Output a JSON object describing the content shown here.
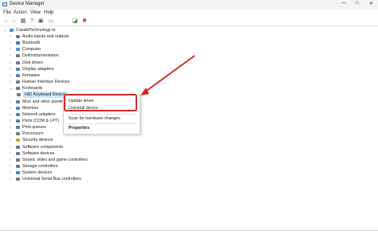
{
  "window": {
    "title": "Device Manager",
    "controls": [
      "—",
      "□",
      "✕"
    ]
  },
  "menu": [
    "File",
    "Action",
    "View",
    "Help"
  ],
  "toolbar": {
    "buttons": [
      {
        "icon": "back-arrow-icon",
        "glyph": "←"
      },
      {
        "icon": "forward-arrow-icon",
        "glyph": "→"
      },
      {
        "icon": "properties-icon",
        "glyph": "▦"
      },
      {
        "icon": "help-icon",
        "glyph": "?"
      },
      {
        "icon": "scan-icon",
        "glyph": "▣"
      },
      {
        "icon": "monitor-icon",
        "glyph": "▭"
      },
      {
        "icon": "update-driver-icon",
        "glyph": "◪"
      },
      {
        "icon": "uninstall-icon",
        "glyph": "✖"
      }
    ]
  },
  "tree": {
    "root": "CandidTechnology-H",
    "nodes": [
      {
        "label": "Audio inputs and outputs",
        "icon": "speaker-icon",
        "color": "#6b7a8c"
      },
      {
        "label": "Bluetooth",
        "icon": "bluetooth-icon",
        "color": "#2a7ad5"
      },
      {
        "label": "Computer",
        "icon": "computer-icon",
        "color": "#4a90d9"
      },
      {
        "label": "DellInstrumentation",
        "icon": "device-icon",
        "color": "#6b7a8c"
      },
      {
        "label": "Disk drives",
        "icon": "disk-icon",
        "color": "#7a7a7a"
      },
      {
        "label": "Display adapters",
        "icon": "display-icon",
        "color": "#3d86c6"
      },
      {
        "label": "Firmware",
        "icon": "chip-icon",
        "color": "#6b7a8c"
      },
      {
        "label": "Human Interface Devices",
        "icon": "hid-icon",
        "color": "#6b7a8c"
      },
      {
        "label": "Keyboards",
        "icon": "keyboard-icon",
        "color": "#6b7a8c",
        "expanded": true
      },
      {
        "label": "HID Keyboard Device",
        "icon": "keyboard-icon",
        "color": "#6b7a8c",
        "child": true,
        "selected": true
      },
      {
        "label": "Mice and other pointing",
        "icon": "mouse-icon",
        "color": "#6b7a8c"
      },
      {
        "label": "Monitors",
        "icon": "monitor-icon",
        "color": "#3d86c6"
      },
      {
        "label": "Network adapters",
        "icon": "network-icon",
        "color": "#3d86c6"
      },
      {
        "label": "Ports (COM & LPT)",
        "icon": "port-icon",
        "color": "#6b7a8c"
      },
      {
        "label": "Print queues",
        "icon": "printer-icon",
        "color": "#6b7a8c"
      },
      {
        "label": "Processors",
        "icon": "processor-icon",
        "color": "#6b7a8c"
      },
      {
        "label": "Security devices",
        "icon": "security-icon",
        "color": "#c9a227"
      },
      {
        "label": "Software components",
        "icon": "component-icon",
        "color": "#6b7a8c"
      },
      {
        "label": "Software devices",
        "icon": "component-icon",
        "color": "#6b7a8c"
      },
      {
        "label": "Sound, video and game controllers",
        "icon": "speaker-icon",
        "color": "#6b7a8c"
      },
      {
        "label": "Storage controllers",
        "icon": "storage-icon",
        "color": "#6b7a8c"
      },
      {
        "label": "System devices",
        "icon": "system-icon",
        "color": "#3d86c6"
      },
      {
        "label": "Universal Serial Bus controllers",
        "icon": "usb-icon",
        "color": "#6b7a8c"
      }
    ]
  },
  "context_menu": {
    "items": [
      {
        "label": "Update driver"
      },
      {
        "label": "Uninstall device"
      },
      {
        "label": "Scan for hardware changes"
      },
      {
        "label": "Properties",
        "bold": true
      }
    ]
  },
  "annotation": {
    "highlight_color": "#d72626"
  }
}
